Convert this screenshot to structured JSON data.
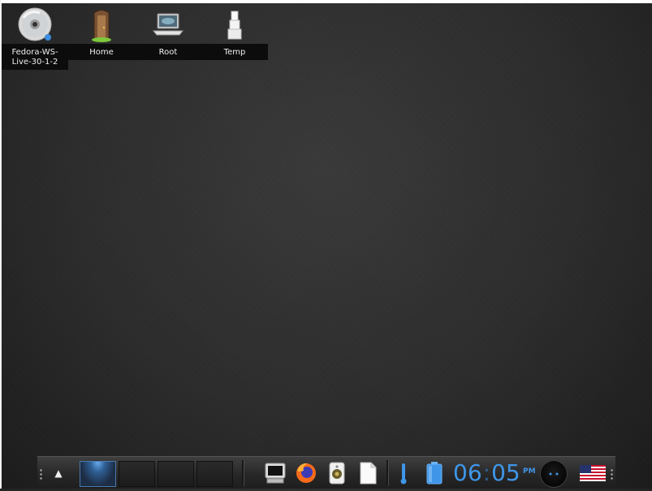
{
  "desktop": {
    "icons": [
      {
        "label_line1": "Fedora-WS-",
        "label_line2": "Live-30-1-2",
        "icon": "cd-disc-icon"
      },
      {
        "label": "Home",
        "icon": "door-icon"
      },
      {
        "label": "Root",
        "icon": "laptop-icon"
      },
      {
        "label": "Temp",
        "icon": "boxes-icon"
      }
    ]
  },
  "taskbar": {
    "virtual_desktops": 4,
    "active_desktop": 1,
    "launchers": [
      "terminal-icon",
      "firefox-icon",
      "speaker-icon",
      "document-icon"
    ],
    "clock": {
      "hours": "06",
      "minutes": "05",
      "ampm": "PM"
    },
    "keyboard_layout": "us-flag-icon"
  },
  "colors": {
    "clock": "#3f96e8",
    "active_desktop": "#4b79ad",
    "label_bg": "#0c0c0c"
  }
}
